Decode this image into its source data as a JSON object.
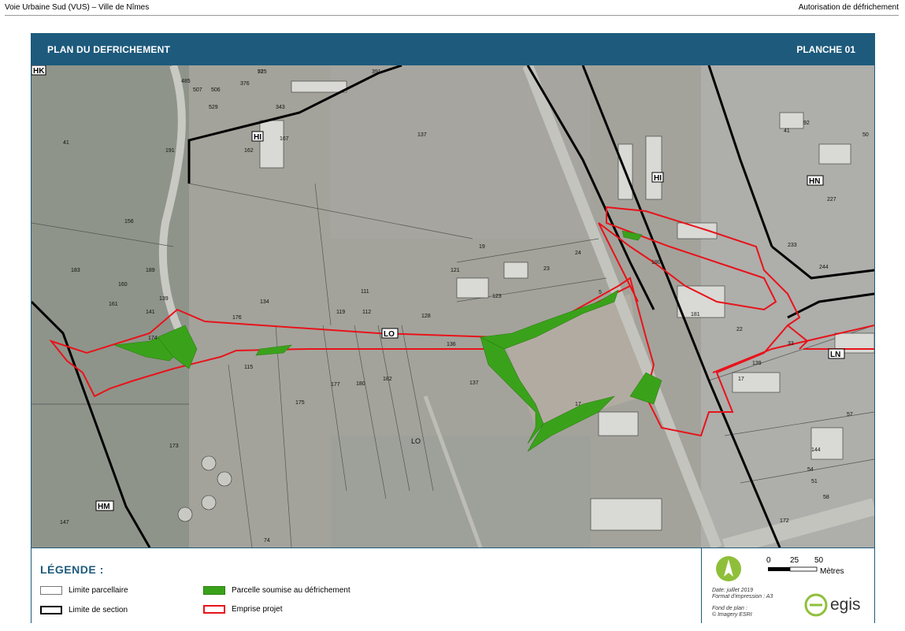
{
  "header": {
    "left": "Voie Urbaine Sud (VUS) – Ville de Nîmes",
    "right": "Autorisation de défrichement"
  },
  "title_bar": {
    "left": "PLAN DU DEFRICHEMENT",
    "right": "PLANCHE 01"
  },
  "map": {
    "sections": [
      "HK",
      "HI",
      "HI",
      "HN",
      "LO",
      "LN",
      "HM"
    ],
    "parcel_numbers": [
      "525",
      "391",
      "485",
      "507",
      "506",
      "529",
      "376",
      "343",
      "137",
      "41",
      "191",
      "162",
      "167",
      "156",
      "189",
      "183",
      "160",
      "161",
      "141",
      "139",
      "134",
      "111",
      "119",
      "112",
      "128",
      "176",
      "174",
      "115",
      "177",
      "180",
      "182",
      "136",
      "137",
      "173",
      "175",
      "17",
      "121",
      "19",
      "23",
      "24",
      "123",
      "5",
      "139",
      "17",
      "41",
      "190",
      "181",
      "22",
      "33",
      "50",
      "244",
      "227",
      "233",
      "144",
      "54",
      "51",
      "58",
      "57",
      "147",
      "74",
      "172",
      "92",
      "71"
    ],
    "text_labels": [
      "LO"
    ],
    "colors": {
      "parcel_subject": "#3aa21a",
      "project_outline": "#e8131a",
      "section_line": "#000000"
    }
  },
  "legend": {
    "title": "LÉGENDE :",
    "items": {
      "parcel_limit": "Limite parcellaire",
      "section_limit": "Limite de section",
      "deforestation": "Parcelle soumise au défrichement",
      "project": "Emprise projet"
    }
  },
  "info": {
    "scale_0": "0",
    "scale_25": "25",
    "scale_50": "50",
    "scale_unit": "Mètres",
    "date": "Date: juillet 2019",
    "format": "Format d'impression : A3",
    "background_label": "Fond de plan :",
    "background_source": "© Imagery ESRI",
    "brand": "egis"
  }
}
